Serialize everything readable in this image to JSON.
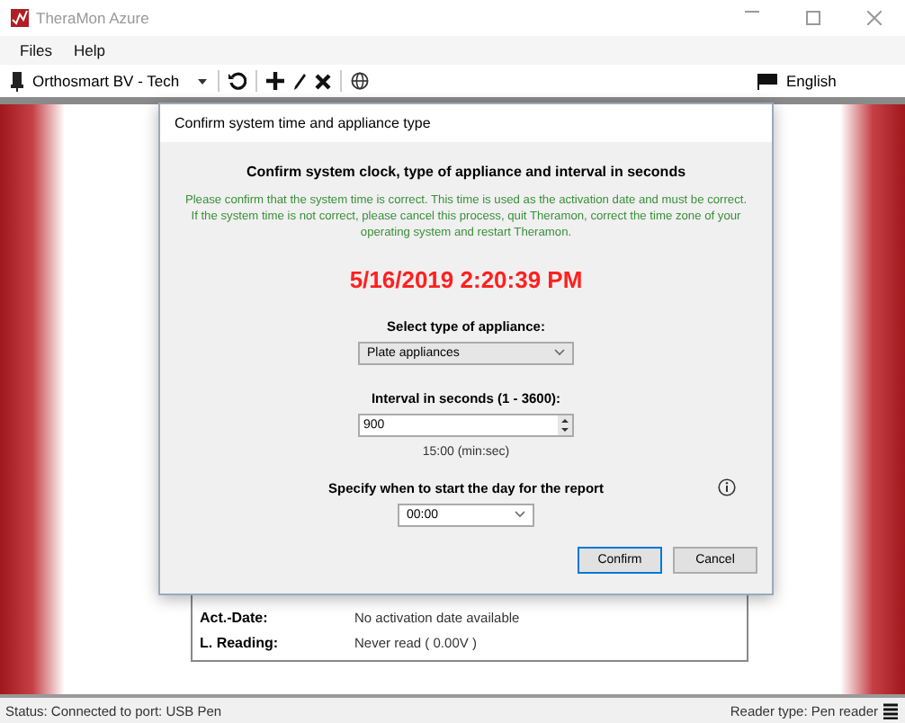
{
  "window": {
    "title": "TheraMon Azure"
  },
  "menu": [
    "Files",
    "Help"
  ],
  "toolbar": {
    "profile": "Orthosmart BV - Tech",
    "language": "English"
  },
  "info_rows": [
    {
      "label": "Act.-Date:",
      "value": "No activation date available"
    },
    {
      "label": "L. Reading:",
      "value": "Never read ( 0.00V )"
    }
  ],
  "dialog": {
    "title": "Confirm system time and appliance type",
    "heading": "Confirm system clock, type of appliance and interval in seconds",
    "notice": "Please confirm that the system time is correct. This time is used as the activation date and must be correct. If the system time is not correct, please cancel this process, quit Theramon, correct the time zone of your operating system and restart Theramon.",
    "clock": "5/16/2019 2:20:39 PM",
    "appliance_label": "Select type of appliance:",
    "appliance": "Plate appliances",
    "interval_label": "Interval in seconds (1 - 3600):",
    "interval": "900",
    "interval_hint": "15:00 (min:sec)",
    "start_label": "Specify when to start the day for the report",
    "start": "00:00",
    "buttons": [
      "Confirm",
      "Cancel"
    ]
  },
  "status_bar": {
    "left": "Status: Connected to port: USB Pen",
    "right": "Reader type: Pen reader"
  }
}
